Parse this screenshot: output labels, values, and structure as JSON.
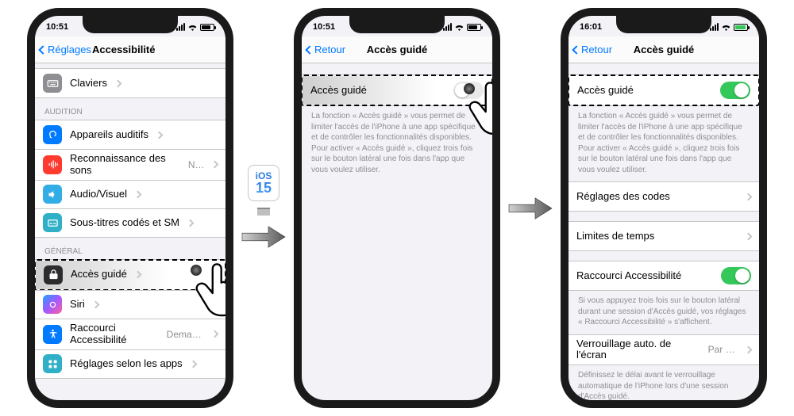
{
  "ios_badge": {
    "line1": "iOS",
    "line2": "15"
  },
  "phone1": {
    "time": "10:51",
    "back_label": "Réglages",
    "title": "Accessibilité",
    "row_claviers": "Claviers",
    "hdr_audition": "AUDITION",
    "row_appareils": "Appareils auditifs",
    "row_reco": "Reconnaissance des sons",
    "row_reco_val": "Non",
    "row_av": "Audio/Visuel",
    "row_st": "Sous-titres codés et SM",
    "hdr_general": "GÉNÉRAL",
    "row_acces": "Accès guidé",
    "row_siri": "Siri",
    "row_raccourci": "Raccourci Accessibilité",
    "row_raccourci_val": "Demander",
    "row_apps": "Réglages selon les apps"
  },
  "phone2": {
    "time": "10:51",
    "back_label": "Retour",
    "title": "Accès guidé",
    "row_toggle": "Accès guidé",
    "footer": "La fonction « Accès guidé » vous permet de limiter l'accès de l'iPhone à une app spécifique et de contrôler les fonctionnalités disponibles. Pour activer « Accès guidé », cliquez trois fois sur le bouton latéral une fois dans l'app que vous voulez utiliser."
  },
  "phone3": {
    "time": "16:01",
    "back_label": "Retour",
    "title": "Accès guidé",
    "row_toggle": "Accès guidé",
    "footer1": "La fonction « Accès guidé » vous permet de limiter l'accès de l'iPhone à une app spécifique et de contrôler les fonctionnalités disponibles. Pour activer « Accès guidé », cliquez trois fois sur le bouton latéral une fois dans l'app que vous voulez utiliser.",
    "row_codes": "Réglages des codes",
    "row_limites": "Limites de temps",
    "row_short": "Raccourci Accessibilité",
    "footer2": "Si vous appuyez trois fois sur le bouton latéral durant une session d'Accès guidé, vos réglages « Raccourci Accessibilité » s'affichent.",
    "row_lock": "Verrouillage auto. de l'écran",
    "row_lock_val": "Par d...",
    "footer3": "Définissez le délai avant le verrouillage automatique de l'iPhone lors d'une session d'Accès guidé."
  }
}
